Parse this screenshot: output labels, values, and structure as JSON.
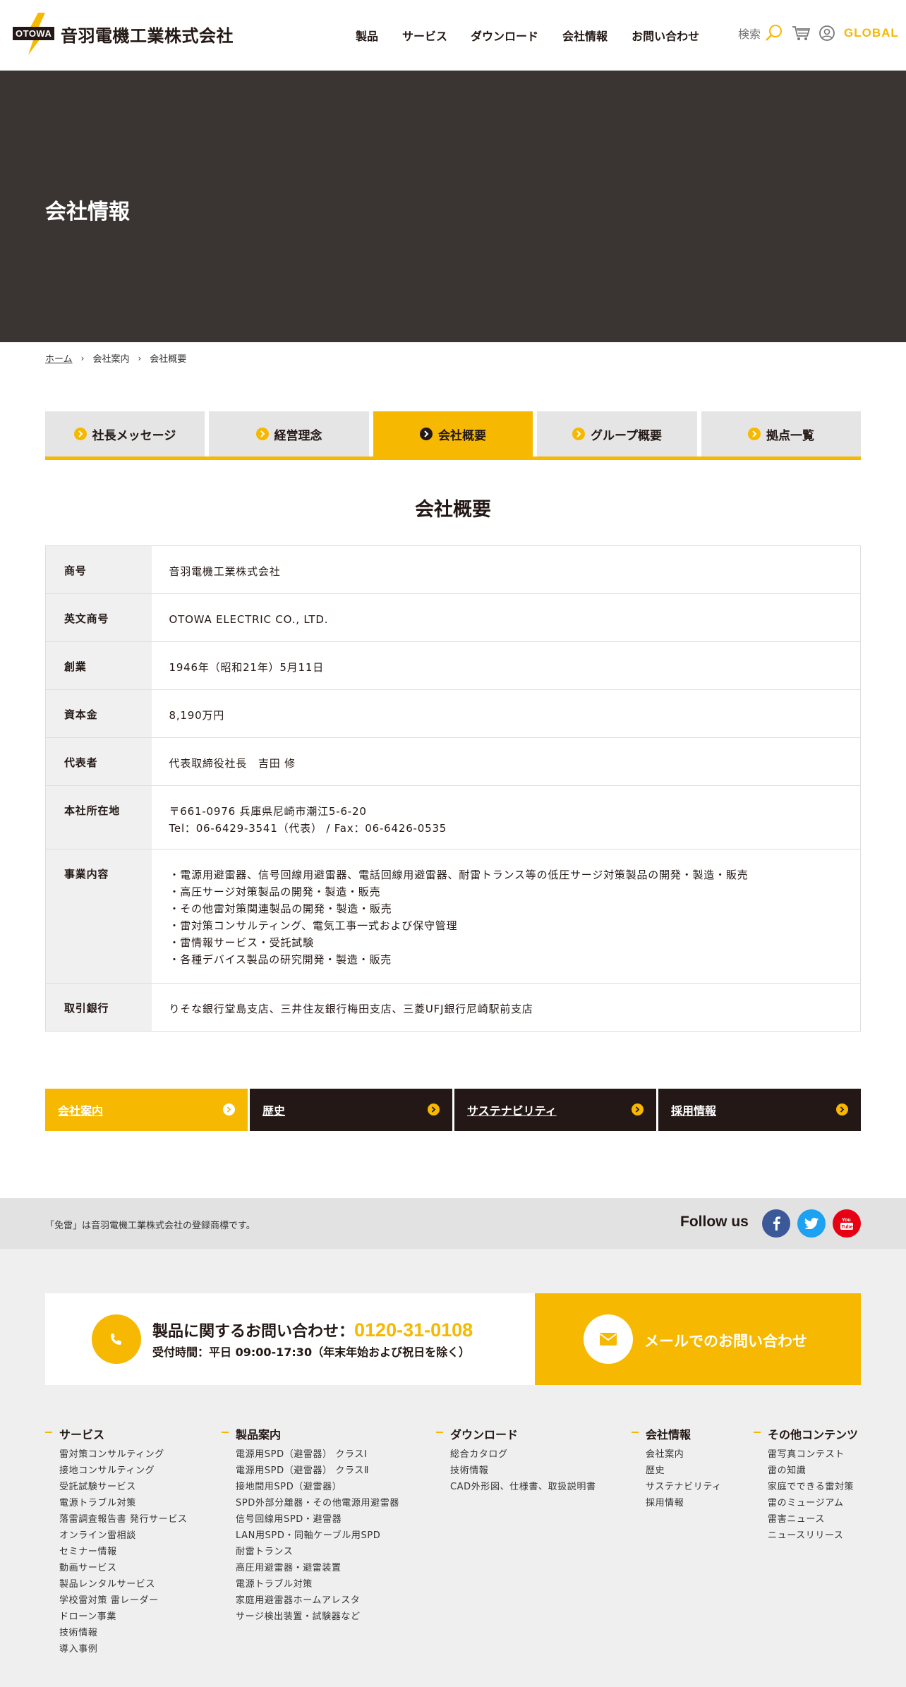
{
  "header": {
    "logo_mark": "OTOWA",
    "logo_text": "音羽電機工業株式会社",
    "nav": [
      "製品",
      "サービス",
      "ダウンロード",
      "会社情報",
      "お問い合わせ"
    ],
    "search_label": "検索",
    "global_label": "GLOBAL"
  },
  "hero": {
    "title": "会社情報"
  },
  "breadcrumb": {
    "home": "ホーム",
    "parent": "会社案内",
    "current": "会社概要"
  },
  "tabs": [
    "社長メッセージ",
    "経営理念",
    "会社概要",
    "グループ概要",
    "拠点一覧"
  ],
  "active_tab": "会社概要",
  "section_title": "会社概要",
  "company_table": [
    {
      "key": "商号",
      "lines": [
        "音羽電機工業株式会社"
      ]
    },
    {
      "key": "英文商号",
      "lines": [
        "OTOWA ELECTRIC CO., LTD."
      ]
    },
    {
      "key": "創業",
      "lines": [
        "1946年（昭和21年）5月11日"
      ]
    },
    {
      "key": "資本金",
      "lines": [
        "8,190万円"
      ]
    },
    {
      "key": "代表者",
      "lines": [
        "代表取締役社長　吉田 修"
      ]
    },
    {
      "key": "本社所在地",
      "lines": [
        "〒661-0976 兵庫県尼崎市潮江5-6-20",
        "Tel：06-6429-3541（代表） / Fax：06-6426-0535"
      ]
    },
    {
      "key": "事業内容",
      "lines": [
        "・電源用避雷器、信号回線用避雷器、電話回線用避雷器、耐雷トランス等の低圧サージ対策製品の開発・製造・販売",
        "・高圧サージ対策製品の開発・製造・販売",
        "・その他雷対策関連製品の開発・製造・販売",
        "・雷対策コンサルティング、電気工事一式および保守管理",
        "・雷情報サービス・受託試験",
        "・各種デバイス製品の研究開発・製造・販売"
      ]
    },
    {
      "key": "取引銀行",
      "lines": [
        "りそな銀行堂島支店、三井住友銀行梅田支店、三菱UFJ銀行尼崎駅前支店"
      ]
    }
  ],
  "subnav": [
    "会社案内",
    "歴史",
    "サステナビリティ",
    "採用情報"
  ],
  "trademark": "「免雷」は音羽電機工業株式会社の登録商標です。",
  "follow_us": "Follow us",
  "social": [
    "facebook-icon",
    "twitter-icon",
    "youtube-icon"
  ],
  "contact": {
    "lead": "製品に関するお問い合わせ：",
    "tel": "0120-31-0108",
    "hours": "受付時間：平日 09:00-17:30（年末年始および祝日を除く）",
    "mail": "メールでのお問い合わせ"
  },
  "footer_columns": [
    {
      "title": "サービス",
      "items": [
        "雷対策コンサルティング",
        "接地コンサルティング",
        "受託試験サービス",
        "電源トラブル対策",
        "落雷調査報告書 発行サービス",
        "オンライン雷相談",
        "セミナー情報",
        "動画サービス",
        "製品レンタルサービス",
        "学校雷対策 雷レーダー",
        "ドローン事業",
        "技術情報",
        "導入事例"
      ]
    },
    {
      "title": "製品案内",
      "items": [
        "電源用SPD（避雷器） クラスⅠ",
        "電源用SPD（避雷器） クラスⅡ",
        "接地間用SPD（避雷器）",
        "SPD外部分離器・その他電源用避雷器",
        "信号回線用SPD・避雷器",
        "LAN用SPD・同軸ケーブル用SPD",
        "耐雷トランス",
        "高圧用避雷器・避雷装置",
        "電源トラブル対策",
        "家庭用避雷器ホームアレスタ",
        "サージ検出装置・試験器など"
      ]
    },
    {
      "title": "ダウンロード",
      "items": [
        "総合カタログ",
        "技術情報",
        "CAD外形図、仕様書、取扱説明書"
      ]
    },
    {
      "title": "会社情報",
      "items": [
        "会社案内",
        "歴史",
        "サステナビリティ",
        "採用情報"
      ]
    },
    {
      "title": "その他コンテンツ",
      "items": [
        "雷写真コンテスト",
        "雷の知識",
        "家庭でできる雷対策",
        "雷のミュージアム",
        "雷害ニュース",
        "ニュースリリース"
      ]
    }
  ],
  "colors": {
    "accent": "#f6b800",
    "dark": "#231815",
    "hero": "#3a3432",
    "facebook": "#3b5998",
    "twitter": "#1da1f2",
    "youtube": "#e60012"
  }
}
